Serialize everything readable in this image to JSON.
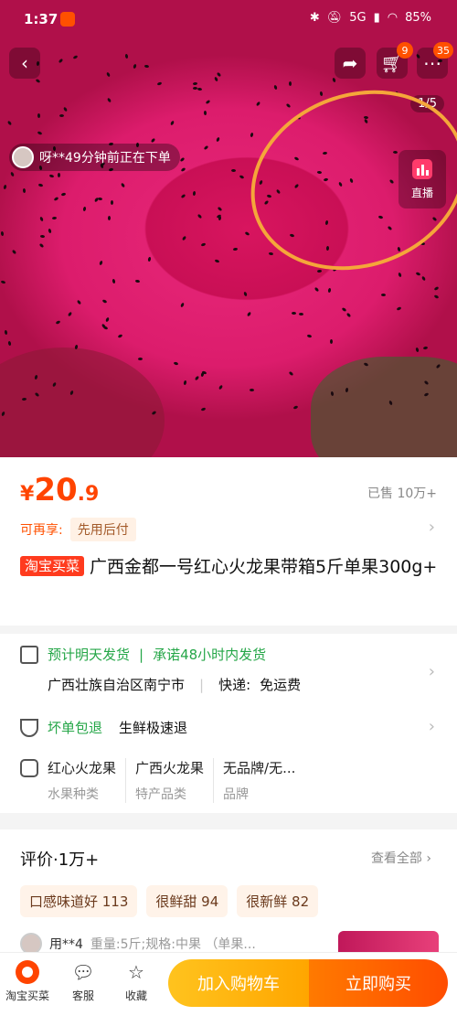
{
  "status_bar": {
    "time": "1:37",
    "battery": "85%",
    "network": "5G"
  },
  "header": {
    "cart_badge": "9",
    "more_badge": "35"
  },
  "gallery": {
    "counter": "1/5",
    "live_label": "直播",
    "ticker": "呀**49分钟前正在下单"
  },
  "product": {
    "price_currency": "¥",
    "price_int": "20",
    "price_dec": ".9",
    "sold": "已售 10万+",
    "enjoy_label": "可再享:",
    "enjoy_tag": "先用后付",
    "title_tag": "淘宝买菜",
    "title": "广西金都一号红心火龙果带箱5斤单果300g+"
  },
  "shipping": {
    "ship_time": "预计明天发货",
    "promise": "承诺48小时内发货",
    "origin": "广西壮族自治区南宁市",
    "express_label": "快递:",
    "express_value": "免运费",
    "guarantee": "坏单包退",
    "fresh": "生鲜极速退"
  },
  "properties": [
    {
      "value": "红心火龙果",
      "key": "水果种类"
    },
    {
      "value": "广西火龙果",
      "key": "特产品类"
    },
    {
      "value": "无品牌/无...",
      "key": "品牌"
    }
  ],
  "reviews": {
    "title": "评价·1万+",
    "view_all": "查看全部",
    "chips": [
      "口感味道好 113",
      "很鲜甜 94",
      "很新鲜 82"
    ],
    "first_user": "用**4",
    "first_meta": "重量:5斤;规格:中果 （单果..."
  },
  "bottom_bar": {
    "shop_label": "淘宝买菜",
    "service_label": "客服",
    "fav_label": "收藏",
    "cart_btn": "加入购物车",
    "buy_btn": "立即购买"
  },
  "colors": {
    "accent": "#ff4400",
    "green": "#24a647",
    "cart_btn": "#ffb300",
    "buy_btn": "#ff5a00"
  }
}
